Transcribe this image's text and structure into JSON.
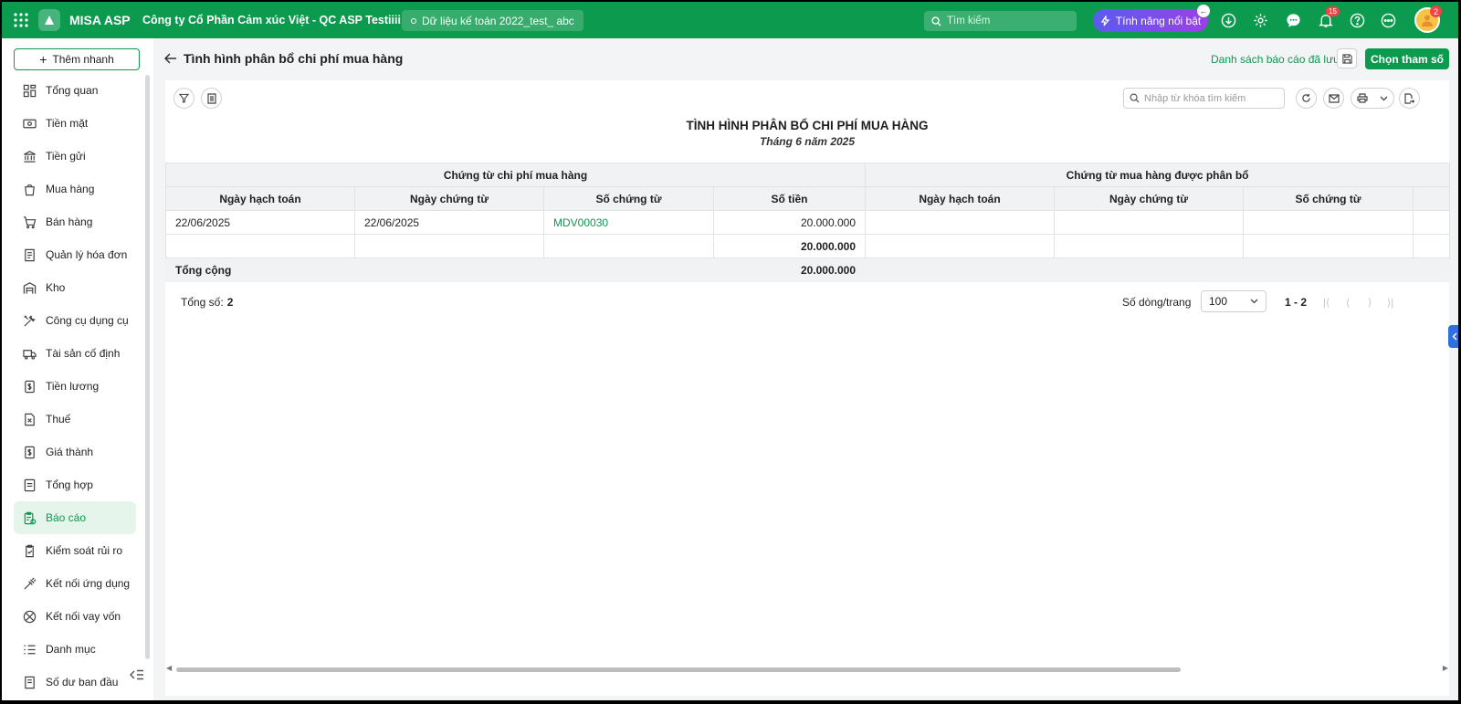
{
  "header": {
    "brand": "MISA ASP",
    "company": "Công ty Cổ Phần Cảm xúc Việt - QC ASP Testiiii",
    "dataset": "Dữ liệu kế toán 2022_test_ abc",
    "search_placeholder": "Tìm kiếm",
    "feature_label": "Tính năng nổi bật",
    "notif_count": "15",
    "avatar_badge": "2",
    "accent_color": "#0b9a4e"
  },
  "sidebar": {
    "quick_add": "Thêm nhanh",
    "items": [
      {
        "label": "Tổng quan",
        "icon": "dashboard-icon"
      },
      {
        "label": "Tiền mặt",
        "icon": "cash-icon"
      },
      {
        "label": "Tiền gửi",
        "icon": "bank-icon"
      },
      {
        "label": "Mua hàng",
        "icon": "shopping-bag-icon"
      },
      {
        "label": "Bán hàng",
        "icon": "cart-icon"
      },
      {
        "label": "Quản lý hóa đơn",
        "icon": "invoice-icon"
      },
      {
        "label": "Kho",
        "icon": "warehouse-icon"
      },
      {
        "label": "Công cụ dụng cụ",
        "icon": "tools-icon"
      },
      {
        "label": "Tài sản cố định",
        "icon": "truck-icon"
      },
      {
        "label": "Tiền lương",
        "icon": "salary-icon"
      },
      {
        "label": "Thuế",
        "icon": "tax-icon"
      },
      {
        "label": "Giá thành",
        "icon": "cost-icon"
      },
      {
        "label": "Tổng hợp",
        "icon": "summary-icon"
      },
      {
        "label": "Báo cáo",
        "icon": "report-icon",
        "active": true
      },
      {
        "label": "Kiểm soát rủi ro",
        "icon": "risk-icon"
      },
      {
        "label": "Kết nối ứng dụng",
        "icon": "plug-icon"
      },
      {
        "label": "Kết nối vay vốn",
        "icon": "loan-icon"
      },
      {
        "label": "Danh mục",
        "icon": "list-icon"
      },
      {
        "label": "Số dư ban đầu",
        "icon": "balance-icon"
      }
    ]
  },
  "page": {
    "title": "Tình hình phân bổ chi phí mua hàng",
    "saved_reports": "Danh sách báo cáo đã lưu",
    "choose_params": "Chọn tham số"
  },
  "report": {
    "keyword_placeholder": "Nhập từ khóa tìm kiếm",
    "title": "TÌNH HÌNH PHÂN BỔ CHI PHÍ MUA HÀNG",
    "subtitle": "Tháng 6 năm 2025",
    "group1": "Chứng từ chi phí mua hàng",
    "group2": "Chứng từ mua hàng được phân bổ",
    "columns": [
      "Ngày hạch toán",
      "Ngày chứng từ",
      "Số chứng từ",
      "Số tiền",
      "Ngày hạch toán",
      "Ngày chứng từ",
      "Số chứng từ"
    ],
    "rows": [
      [
        "22/06/2025",
        "22/06/2025",
        "MDV00030",
        "20.000.000",
        "",
        "",
        "",
        ""
      ],
      [
        "",
        "",
        "",
        "20.000.000",
        "",
        "",
        "",
        ""
      ]
    ],
    "total_label": "Tổng cộng",
    "total_value": "20.000.000"
  },
  "pager": {
    "total_label": "Tổng số:",
    "total_count": "2",
    "rows_per_page_label": "Số dòng/trang",
    "rows_per_page": "100",
    "range": "1 - 2"
  }
}
